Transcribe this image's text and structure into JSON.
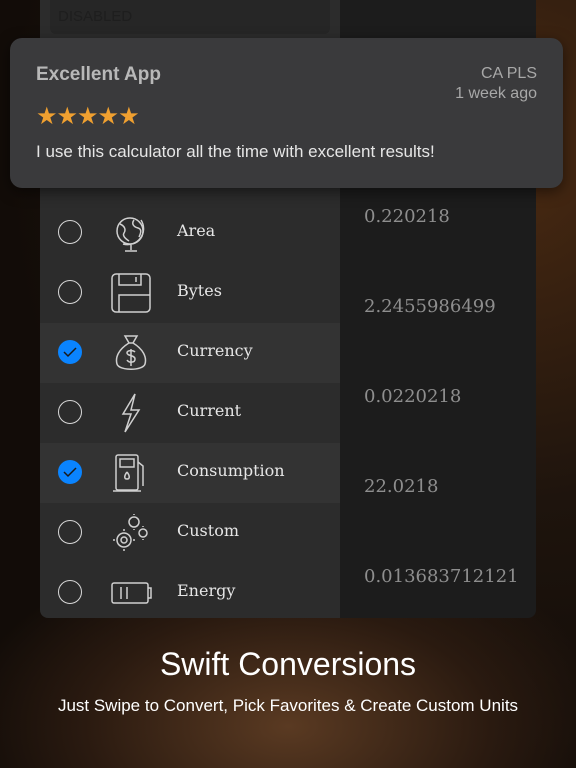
{
  "app": {
    "disabled_label": "DISABLED",
    "categories": [
      {
        "label": "Area",
        "icon": "globe-icon",
        "checked": false
      },
      {
        "label": "Bytes",
        "icon": "floppy-disk-icon",
        "checked": false
      },
      {
        "label": "Currency",
        "icon": "money-bag-icon",
        "checked": true
      },
      {
        "label": "Current",
        "icon": "lightning-icon",
        "checked": false
      },
      {
        "label": "Consumption",
        "icon": "fuel-pump-icon",
        "checked": true
      },
      {
        "label": "Custom",
        "icon": "gears-icon",
        "checked": false
      },
      {
        "label": "Energy",
        "icon": "battery-icon",
        "checked": false
      }
    ],
    "values": [
      "0.220218",
      "2.2455986499",
      "0.0220218",
      "22.0218",
      "0.013683712121"
    ]
  },
  "review": {
    "title": "Excellent App",
    "author": "CA PLS",
    "date": "1 week ago",
    "rating": 5,
    "stars": "★★★★★",
    "body": "I use this calculator all the time with excellent results!"
  },
  "promo": {
    "title": "Swift Conversions",
    "subtitle": "Just Swipe to Convert, Pick Favorites & Create Custom Units"
  },
  "colors": {
    "accent": "#0a84ff",
    "star": "#f0a030"
  }
}
